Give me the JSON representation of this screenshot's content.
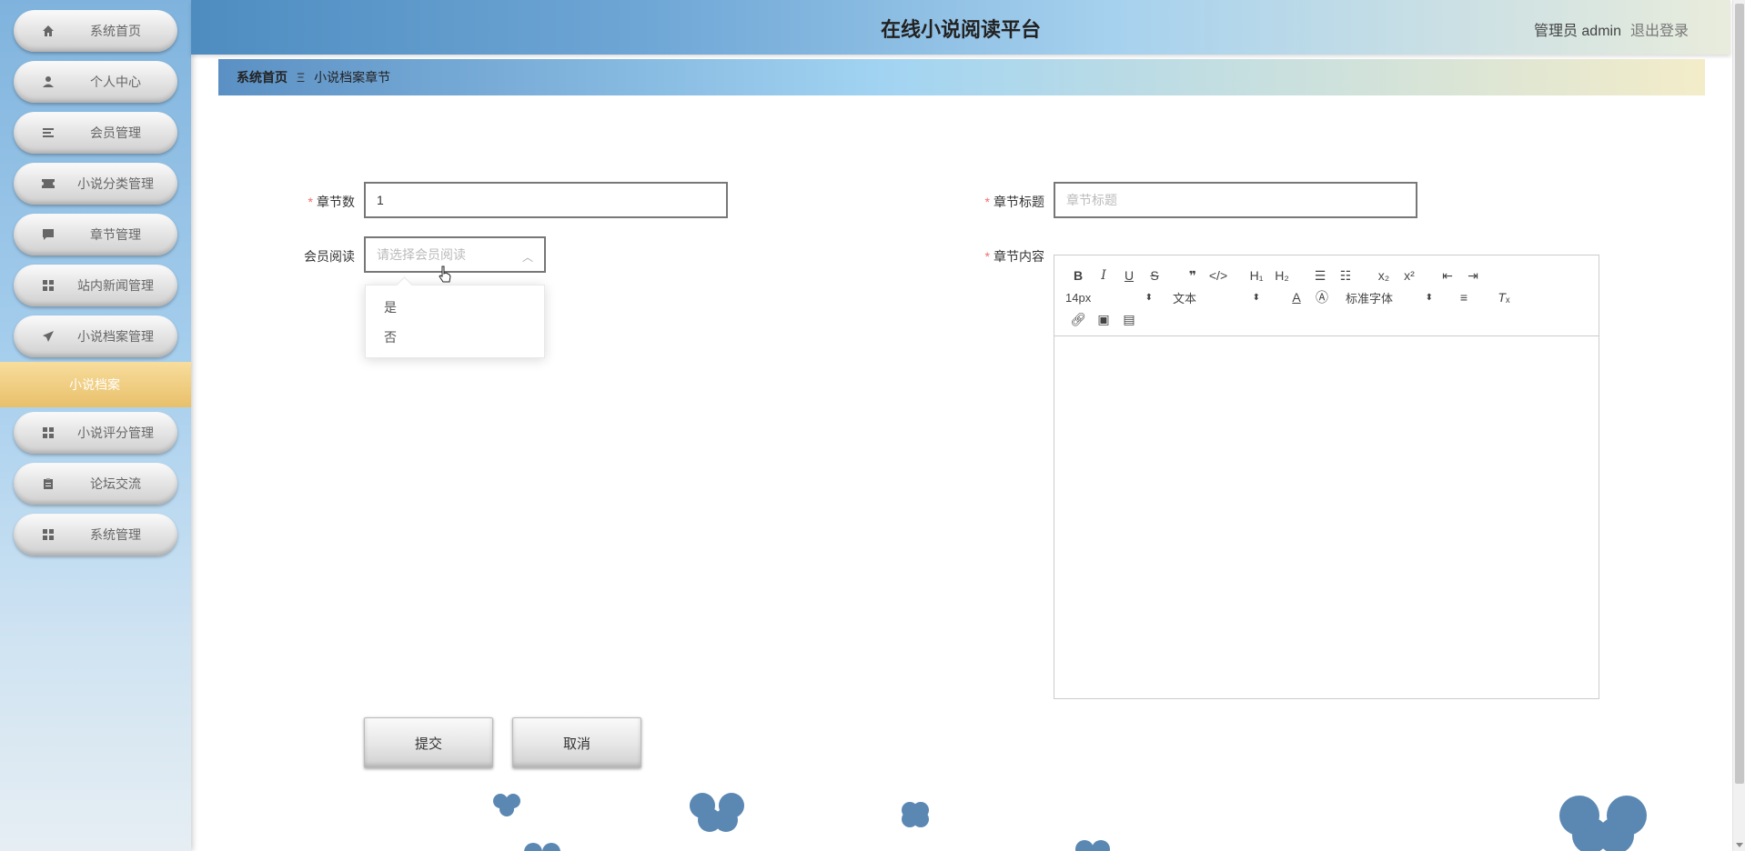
{
  "app": {
    "title": "在线小说阅读平台"
  },
  "header": {
    "user_label": "管理员 admin",
    "logout_label": "退出登录"
  },
  "sidebar": {
    "items": [
      {
        "label": "系统首页",
        "icon": "home-icon"
      },
      {
        "label": "个人中心",
        "icon": "user-icon"
      },
      {
        "label": "会员管理",
        "icon": "list-icon"
      },
      {
        "label": "小说分类管理",
        "icon": "ticket-icon"
      },
      {
        "label": "章节管理",
        "icon": "chat-icon"
      },
      {
        "label": "站内新闻管理",
        "icon": "grid-icon"
      },
      {
        "label": "小说档案管理",
        "icon": "send-icon"
      },
      {
        "label": "小说评分管理",
        "icon": "grid-icon"
      },
      {
        "label": "论坛交流",
        "icon": "clipboard-icon"
      },
      {
        "label": "系统管理",
        "icon": "grid-icon"
      }
    ],
    "sub_item": {
      "label": "小说档案"
    }
  },
  "breadcrumb": {
    "home": "系统首页",
    "separator": "Ξ",
    "current": "小说档案章节"
  },
  "form": {
    "chapter_number": {
      "label": "章节数",
      "value": "1"
    },
    "chapter_title": {
      "label": "章节标题",
      "placeholder": "章节标题"
    },
    "member_read": {
      "label": "会员阅读",
      "placeholder": "请选择会员阅读",
      "options": [
        "是",
        "否"
      ]
    },
    "chapter_content": {
      "label": "章节内容"
    }
  },
  "editor": {
    "font_size": "14px",
    "format": "文本",
    "font_family": "标准字体"
  },
  "buttons": {
    "submit": "提交",
    "cancel": "取消"
  },
  "colors": {
    "required": "#f56c6c",
    "accent_gold": "#e8c06b",
    "header_blue": "#4e8cc0"
  }
}
